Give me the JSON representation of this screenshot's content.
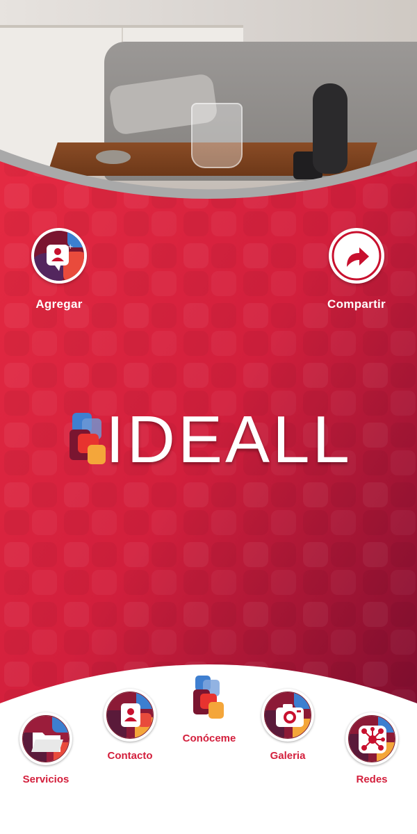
{
  "colors": {
    "red_top": "#e52a42",
    "red_bottom": "#7a0c2e",
    "label_red": "#d31f3c",
    "white": "#ffffff"
  },
  "header": {
    "add_label": "Agregar",
    "add_icon": "add-contact-icon",
    "share_label": "Compartir",
    "share_icon": "share-arrow-icon"
  },
  "brand": {
    "name": "IDEALL",
    "logo_icon": "ideall-logo-icon"
  },
  "nav": {
    "items": [
      {
        "label": "Servicios",
        "icon": "folder-icon"
      },
      {
        "label": "Contacto",
        "icon": "contact-card-icon"
      },
      {
        "label": "Conóceme",
        "icon": "ideall-logo-icon"
      },
      {
        "label": "Galeria",
        "icon": "camera-icon"
      },
      {
        "label": "Redes",
        "icon": "network-icon"
      }
    ]
  }
}
